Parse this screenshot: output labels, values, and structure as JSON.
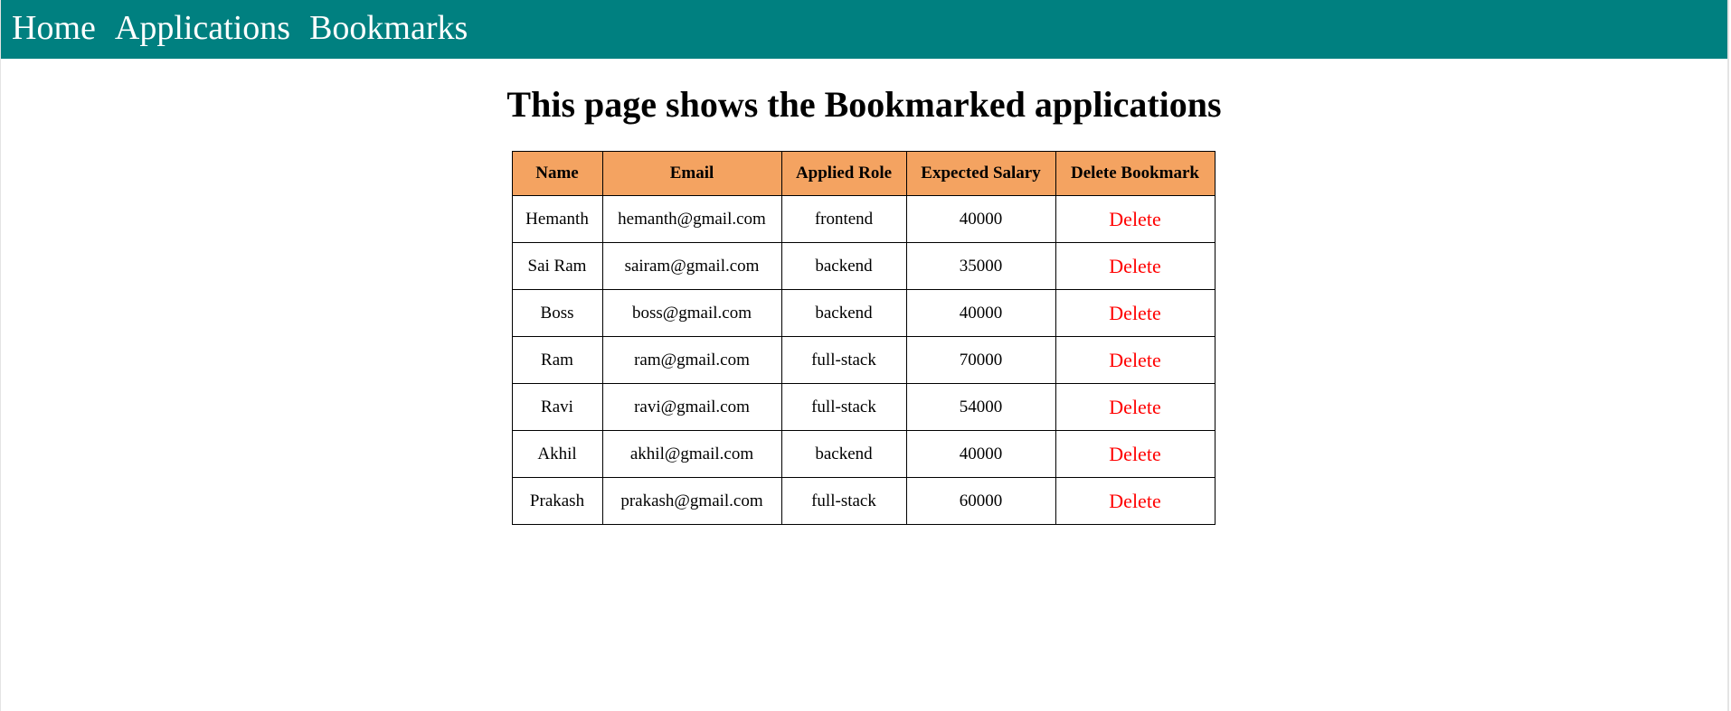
{
  "nav": {
    "home": "Home",
    "applications": "Applications",
    "bookmarks": "Bookmarks"
  },
  "page_title": "This page shows the Bookmarked applications",
  "table": {
    "headers": [
      "Name",
      "Email",
      "Applied Role",
      "Expected Salary",
      "Delete Bookmark"
    ],
    "rows": [
      {
        "name": "Hemanth",
        "email": "hemanth@gmail.com",
        "role": "frontend",
        "salary": "40000",
        "action": "Delete"
      },
      {
        "name": "Sai Ram",
        "email": "sairam@gmail.com",
        "role": "backend",
        "salary": "35000",
        "action": "Delete"
      },
      {
        "name": "Boss",
        "email": "boss@gmail.com",
        "role": "backend",
        "salary": "40000",
        "action": "Delete"
      },
      {
        "name": "Ram",
        "email": "ram@gmail.com",
        "role": "full-stack",
        "salary": "70000",
        "action": "Delete"
      },
      {
        "name": "Ravi",
        "email": "ravi@gmail.com",
        "role": "full-stack",
        "salary": "54000",
        "action": "Delete"
      },
      {
        "name": "Akhil",
        "email": "akhil@gmail.com",
        "role": "backend",
        "salary": "40000",
        "action": "Delete"
      },
      {
        "name": "Prakash",
        "email": "prakash@gmail.com",
        "role": "full-stack",
        "salary": "60000",
        "action": "Delete"
      }
    ]
  },
  "colors": {
    "nav_background": "#008080",
    "header_background": "#f4a361",
    "delete_text": "#ff0000"
  }
}
